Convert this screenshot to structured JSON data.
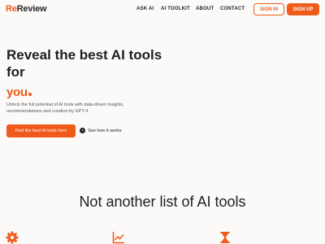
{
  "nav": {
    "logo_prefix": "Re",
    "logo_suffix": "Review",
    "links": [
      "ASK AI",
      "AI TOOLKIT",
      "ABOUT",
      "CONTACT"
    ],
    "signin_label": "SIGN IN",
    "signup_label": "SIGN UP"
  },
  "hero": {
    "headline": "Reveal the best AI tools for",
    "highlight": "you",
    "subtitle": "Unlock the full potential of AI tools with data-driven insights, recommendations and curation by GPT-4",
    "cta_label": "Find the best AI tools here",
    "secondary_label": "See how it works"
  },
  "features": {
    "title": "Not another list of AI tools",
    "icons": [
      "gear-icon",
      "chart-icon",
      "hourglass-icon"
    ]
  },
  "colors": {
    "accent": "#f05a1a",
    "background": "#fbfaf9"
  }
}
